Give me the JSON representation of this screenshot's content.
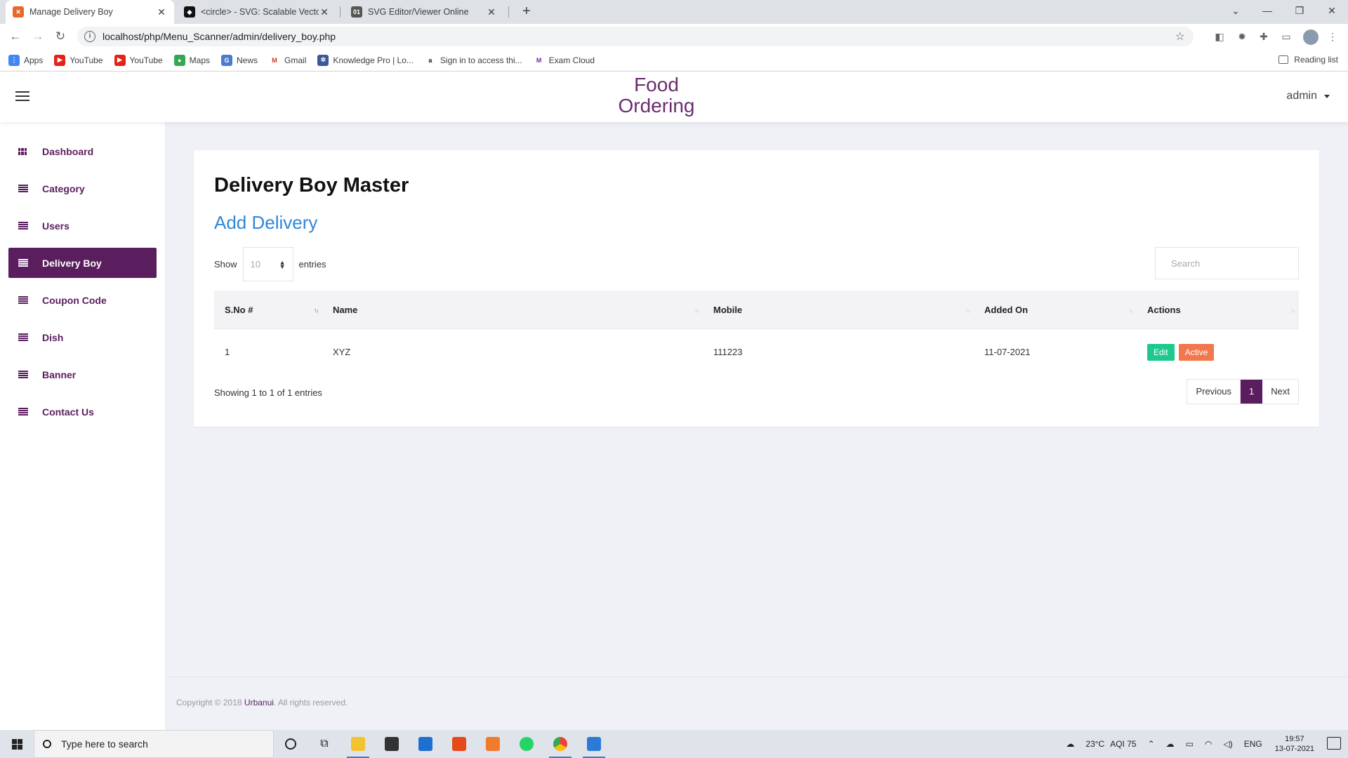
{
  "browser": {
    "tabs": [
      {
        "title": "Manage Delivery Boy",
        "active": true
      },
      {
        "title": "<circle> - SVG: Scalable Vector G",
        "active": false
      },
      {
        "title": "SVG Editor/Viewer Online",
        "active": false
      }
    ],
    "url": "localhost/php/Menu_Scanner/admin/delivery_boy.php",
    "bookmarks": [
      "Apps",
      "YouTube",
      "YouTube",
      "Maps",
      "News",
      "Gmail",
      "Knowledge Pro | Lo...",
      "Sign in to access thi...",
      "Exam Cloud"
    ],
    "reading_list": "Reading list"
  },
  "header": {
    "brand_line1": "Food",
    "brand_line2": "Ordering",
    "user": "admin"
  },
  "sidebar": {
    "items": [
      {
        "label": "Dashboard",
        "icon": "dashboard-icon",
        "active": false
      },
      {
        "label": "Category",
        "icon": "list-icon",
        "active": false
      },
      {
        "label": "Users",
        "icon": "list-icon",
        "active": false
      },
      {
        "label": "Delivery Boy",
        "icon": "list-icon",
        "active": true
      },
      {
        "label": "Coupon Code",
        "icon": "list-icon",
        "active": false
      },
      {
        "label": "Dish",
        "icon": "list-icon",
        "active": false
      },
      {
        "label": "Banner",
        "icon": "list-icon",
        "active": false
      },
      {
        "label": "Contact Us",
        "icon": "list-icon",
        "active": false
      }
    ]
  },
  "page": {
    "title": "Delivery Boy Master",
    "add_link": "Add Delivery",
    "show_label": "Show",
    "entries_label": "entries",
    "page_length": "10",
    "search_placeholder": "Search",
    "columns": [
      "S.No #",
      "Name",
      "Mobile",
      "Added On",
      "Actions"
    ],
    "rows": [
      {
        "sno": "1",
        "name": "XYZ",
        "mobile": "111223",
        "added_on": "11-07-2021",
        "edit_label": "Edit",
        "status_label": "Active"
      }
    ],
    "info": "Showing 1 to 1 of 1 entries",
    "pagination": {
      "previous": "Previous",
      "current": "1",
      "next": "Next"
    }
  },
  "footer": {
    "copyright_prefix": "Copyright © 2018 ",
    "company": "Urbanui",
    "copyright_suffix": ". All rights reserved."
  },
  "taskbar": {
    "search_placeholder": "Type here to search",
    "weather": "23°C",
    "aqi": "AQI 75",
    "lang": "ENG",
    "time": "19:57",
    "date": "13-07-2021"
  },
  "colors": {
    "brand": "#5a1d5e",
    "link": "#2f86d8",
    "edit": "#1ec98f",
    "status_active": "#f2774d",
    "content_bg": "#eff1f7"
  }
}
